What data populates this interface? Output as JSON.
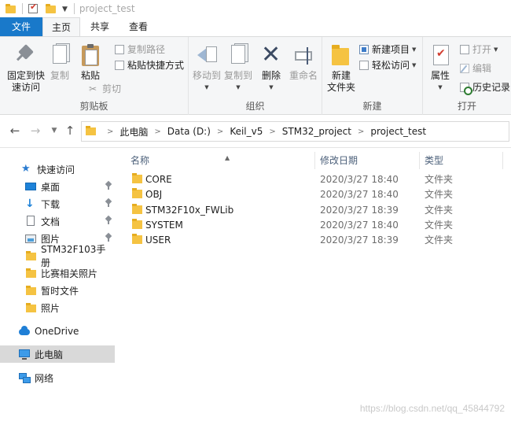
{
  "window": {
    "title": "project_test"
  },
  "ribbon_tabs": [
    "文件",
    "主页",
    "共享",
    "查看"
  ],
  "ribbon": {
    "clipboard": {
      "label": "剪贴板",
      "pin_quick_access": "固定到快\n速访问",
      "copy": "复制",
      "paste": "粘贴",
      "copy_path": "复制路径",
      "paste_shortcut": "粘贴快捷方式",
      "cut": "剪切"
    },
    "organize": {
      "label": "组织",
      "move_to": "移动到",
      "copy_to": "复制到",
      "delete": "删除",
      "rename": "重命名"
    },
    "new": {
      "label": "新建",
      "new_folder": "新建\n文件夹",
      "new_item": "新建项目",
      "easy_access": "轻松访问"
    },
    "open": {
      "label": "打开",
      "properties": "属性",
      "open": "打开",
      "edit": "编辑",
      "history": "历史记录"
    }
  },
  "address": {
    "crumbs": [
      "此电脑",
      "Data (D:)",
      "Keil_v5",
      "STM32_project",
      "project_test"
    ]
  },
  "nav_pane": {
    "items": [
      {
        "label": "快速访问",
        "icon": "star-icon"
      },
      {
        "label": "桌面",
        "icon": "desktop-icon",
        "pinned": true
      },
      {
        "label": "下载",
        "icon": "download-icon",
        "pinned": true
      },
      {
        "label": "文档",
        "icon": "document-icon",
        "pinned": true
      },
      {
        "label": "图片",
        "icon": "pictures-icon",
        "pinned": true
      },
      {
        "label": "STM32F103手册",
        "icon": "folder-icon"
      },
      {
        "label": "比赛相关照片",
        "icon": "folder-icon"
      },
      {
        "label": "暂时文件",
        "icon": "folder-icon"
      },
      {
        "label": "照片",
        "icon": "folder-icon"
      },
      {
        "label": "OneDrive",
        "icon": "onedrive-icon"
      },
      {
        "label": "此电脑",
        "icon": "this-pc-icon"
      },
      {
        "label": "网络",
        "icon": "network-icon"
      }
    ]
  },
  "file_list": {
    "columns": [
      "名称",
      "修改日期",
      "类型"
    ],
    "rows": [
      {
        "name": "CORE",
        "date": "2020/3/27 18:40",
        "type": "文件夹"
      },
      {
        "name": "OBJ",
        "date": "2020/3/27 18:40",
        "type": "文件夹"
      },
      {
        "name": "STM32F10x_FWLib",
        "date": "2020/3/27 18:39",
        "type": "文件夹"
      },
      {
        "name": "SYSTEM",
        "date": "2020/3/27 18:40",
        "type": "文件夹"
      },
      {
        "name": "USER",
        "date": "2020/3/27 18:39",
        "type": "文件夹"
      }
    ]
  },
  "watermark": "https://blog.csdn.net/qq_45844792",
  "colors": {
    "accent": "#1979ca",
    "folder": "#f5c342",
    "selected_nav": "#d9d9d9"
  }
}
